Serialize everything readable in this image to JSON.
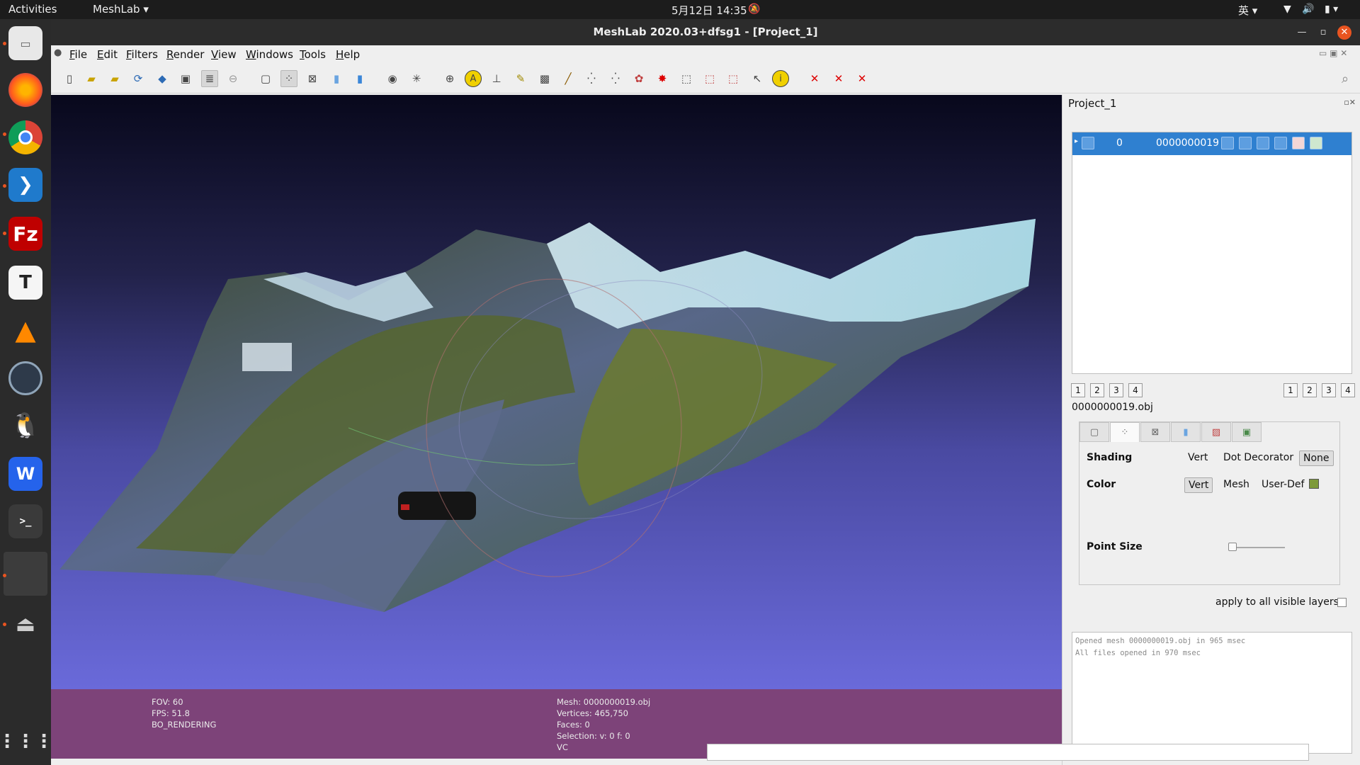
{
  "topbar": {
    "activities": "Activities",
    "app_menu": "MeshLab ▾",
    "clock": "5月12日  14:35",
    "lang": "英 ▾"
  },
  "dock": {
    "apps": [
      "files",
      "firefox",
      "chrome",
      "vscode",
      "filezilla",
      "typora",
      "vlc",
      "monitor",
      "qq",
      "wps",
      "terminal",
      "blank",
      "usb"
    ]
  },
  "window": {
    "title": "MeshLab 2020.03+dfsg1 - [Project_1]"
  },
  "menu": [
    "File",
    "Edit",
    "Filters",
    "Render",
    "View",
    "Windows",
    "Tools",
    "Help"
  ],
  "viewport": {
    "left_info": [
      "FOV: 60",
      "FPS:   51.8",
      "BO_RENDERING"
    ],
    "right_info": [
      "Mesh: 0000000019.obj",
      "Vertices: 465,750",
      "Faces: 0",
      "Selection: v: 0 f: 0",
      "VC"
    ]
  },
  "panel": {
    "title": "Project_1",
    "layer": {
      "index": "0",
      "name": "0000000019"
    },
    "left_numbers": [
      "1",
      "2",
      "3",
      "4"
    ],
    "right_numbers": [
      "1",
      "2",
      "3",
      "4"
    ],
    "mesh_name": "0000000019.obj",
    "shading": {
      "label": "Shading",
      "options": [
        "Vert",
        "Dot Decorator",
        "None"
      ],
      "selected": "None"
    },
    "color": {
      "label": "Color",
      "options": [
        "Vert",
        "Mesh",
        "User-Def"
      ],
      "selected": "Vert",
      "swatch": "#7e9a3a"
    },
    "point_size": {
      "label": "Point Size",
      "value": 0.0
    },
    "apply_all": "apply to all visible layers",
    "log": [
      "Opened mesh 0000000019.obj in 965 msec",
      "All files opened in 970 msec"
    ]
  },
  "colors": {
    "accent": "#e95420",
    "selection": "#2f80d0",
    "infobar": "#7d4379"
  }
}
